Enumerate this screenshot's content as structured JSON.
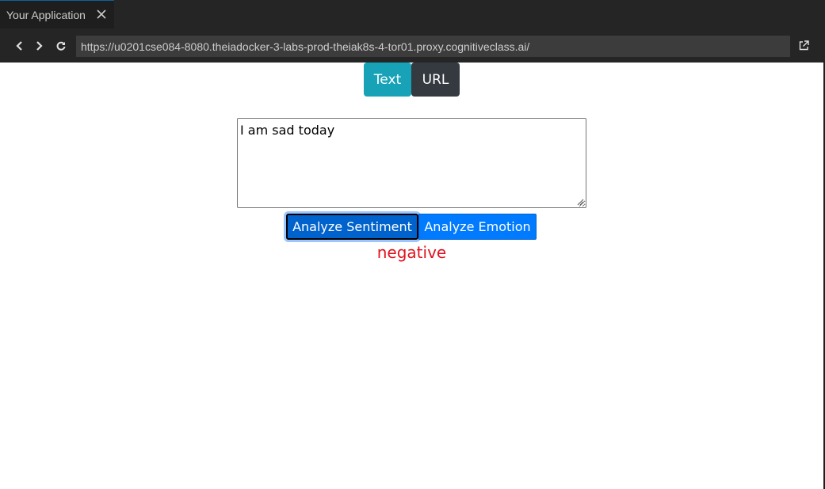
{
  "tab": {
    "title": "Your Application"
  },
  "toolbar": {
    "url": "https://u0201cse084-8080.theiadocker-3-labs-prod-theiak8s-4-tor01.proxy.cognitiveclass.ai/"
  },
  "page": {
    "modes": [
      {
        "label": "Text",
        "color": "#17a2b8"
      },
      {
        "label": "URL",
        "color": "#343a40"
      }
    ],
    "input_text": "I am sad today",
    "buttons": {
      "sentiment_label": "Analyze Sentiment",
      "emotion_label": "Analyze Emotion",
      "color": "#007bff"
    },
    "result": {
      "text": "negative",
      "color": "#e0141e"
    }
  }
}
